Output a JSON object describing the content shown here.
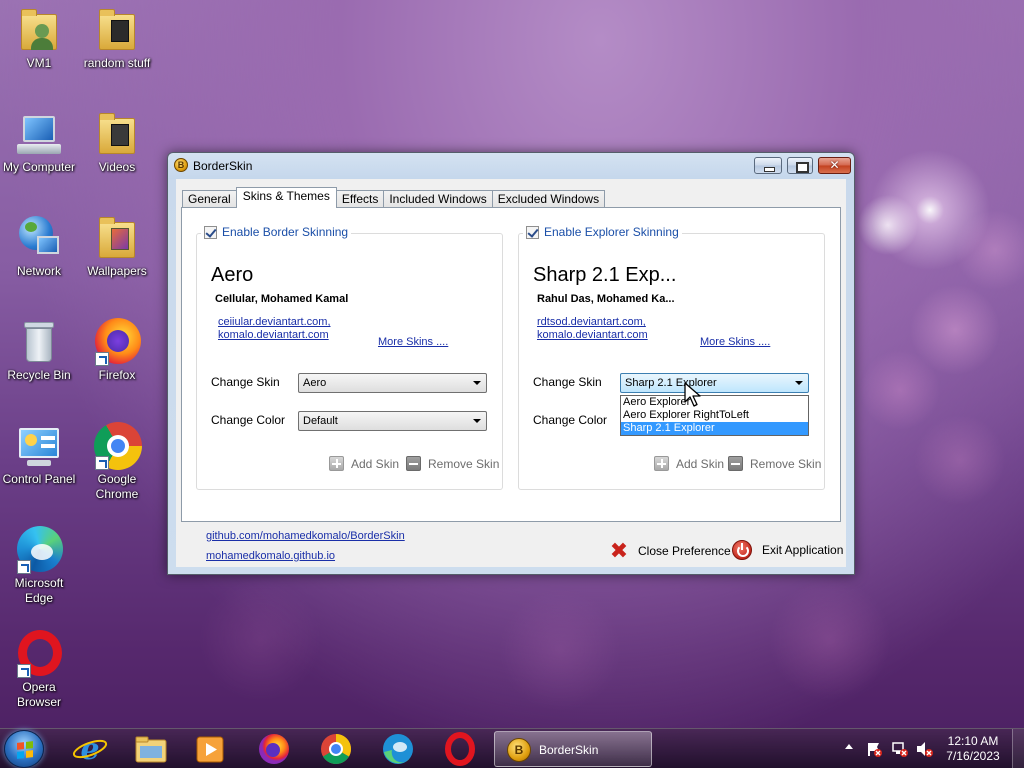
{
  "desktop": {
    "icons": [
      {
        "label": "VM1"
      },
      {
        "label": "random stuff"
      },
      {
        "label": "My Computer"
      },
      {
        "label": "Videos"
      },
      {
        "label": "Network"
      },
      {
        "label": "Wallpapers"
      },
      {
        "label": "Recycle Bin"
      },
      {
        "label": "Firefox"
      },
      {
        "label": "Control Panel"
      },
      {
        "label": "Google Chrome"
      },
      {
        "label": "Microsoft Edge"
      },
      {
        "label": "Opera Browser"
      }
    ]
  },
  "window": {
    "title": "BorderSkin",
    "tabs": [
      {
        "label": "General",
        "active": false
      },
      {
        "label": "Skins & Themes",
        "active": true
      },
      {
        "label": "Effects",
        "active": false
      },
      {
        "label": "Included Windows",
        "active": false
      },
      {
        "label": "Excluded Windows",
        "active": false
      }
    ],
    "border_group": {
      "checkbox_label": "Enable Border Skinning",
      "checked": true,
      "skin_name": "Aero",
      "author": "CeIlular, Mohamed Kamal",
      "links": [
        "ceiiular.deviantart.com,",
        "komalo.deviantart.com"
      ],
      "more_skins": "More Skins ....",
      "change_skin_label": "Change Skin",
      "change_skin_value": "Aero",
      "change_color_label": "Change Color",
      "change_color_value": "Default",
      "add_skin": "Add Skin",
      "remove_skin": "Remove Skin"
    },
    "explorer_group": {
      "checkbox_label": "Enable Explorer Skinning",
      "checked": true,
      "skin_name": "Sharp 2.1 Exp...",
      "author": "Rahul Das, Mohamed Ka...",
      "links": [
        "rdtsod.deviantart.com,",
        "komalo.deviantart.com"
      ],
      "more_skins": "More Skins ....",
      "change_skin_label": "Change Skin",
      "change_skin_value": "Sharp 2.1 Explorer",
      "change_skin_options": [
        "Aero Explorer",
        "Aero Explorer RightToLeft",
        "Sharp 2.1 Explorer"
      ],
      "change_color_label": "Change Color",
      "add_skin": "Add Skin",
      "remove_skin": "Remove Skin"
    },
    "footer": {
      "github_link": "github.com/mohamedkomalo/BorderSkin",
      "site_link": "mohamedkomalo.github.io",
      "close_preference": "Close Preference",
      "exit_application": "Exit Application"
    }
  },
  "taskbar": {
    "pinned": [
      "internet-explorer-icon",
      "file-explorer-icon",
      "media-player-icon",
      "firefox-icon",
      "chrome-icon",
      "edge-icon",
      "opera-icon"
    ],
    "active_app": "BorderSkin",
    "time": "12:10 AM",
    "date": "7/16/2023"
  },
  "colors": {
    "link": "#1a2fa8",
    "legend": "#1b4fa8",
    "selection": "#3399ff",
    "close_red": "#c9231b"
  }
}
